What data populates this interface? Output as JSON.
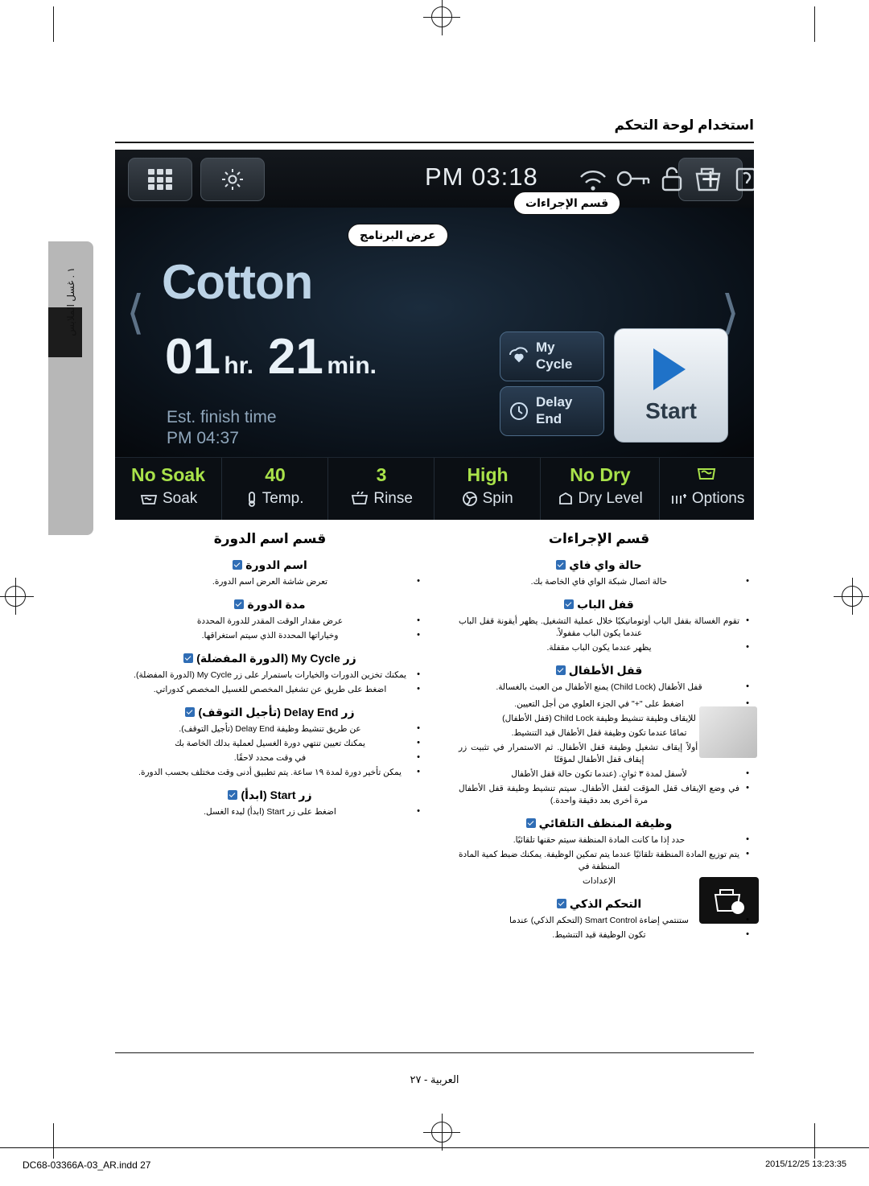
{
  "header": {
    "title": "استخدام لوحة التحكم"
  },
  "side_tab": {
    "label": "١ . غسل الملابس"
  },
  "footer": {
    "page_label": "العربية - ٢٧"
  },
  "print_bar": {
    "file": "DC68-03366A-03_AR.indd   27",
    "timestamp": "2015/12/25   13:23:35"
  },
  "display": {
    "clock": "PM 03:18",
    "icons": {
      "apps": "apps-grid-icon",
      "gear": "gear-icon",
      "plus": "plus-icon",
      "wifi": "wifi-icon",
      "key": "key-icon",
      "door_lock": "door-lock-icon",
      "detergent": "detergent-icon",
      "child_lock": "child-lock-icon"
    },
    "cycle_name": "Cotton",
    "hours": "01",
    "hours_unit": "hr.",
    "minutes": "21",
    "minutes_unit": "min.",
    "est_label": "Est. finish time",
    "est_time": "PM 04:37",
    "my_cycle": "My\nCycle",
    "my_cycle_line1": "My",
    "my_cycle_line2": "Cycle",
    "delay_line1": "Delay",
    "delay_line2": "End",
    "start": "Start",
    "options": [
      {
        "value": "No Soak",
        "name": "Soak",
        "icon": "soak-icon"
      },
      {
        "value": "40",
        "name": "Temp.",
        "icon": "thermometer-icon"
      },
      {
        "value": "3",
        "name": "Rinse",
        "icon": "rinse-icon"
      },
      {
        "value": "High",
        "name": "Spin",
        "icon": "spin-icon"
      },
      {
        "value": "No Dry",
        "name": "Dry Level",
        "icon": "dry-level-icon"
      },
      {
        "value": "",
        "name": "Options",
        "icon": "options-icon"
      }
    ],
    "callouts": {
      "program_display": "عرض البرنامج",
      "procedures_section": "قسم الإجراءات"
    }
  },
  "right_column": {
    "title": "قسم الإجراءات",
    "sections": [
      {
        "heading": "حالة واي فاي",
        "items": [
          "حالة اتصال شبكة الواي فاي الخاصة بك."
        ]
      },
      {
        "heading": "قفل الباب",
        "items": [
          "تقوم الغسالة بقفل الباب أوتوماتيكيًا خلال عملية التشغيل. يظهر أيقونة قفل الباب عندما يكون الباب مقفولاً.",
          "يظهر عندما يكون الباب مقفلة."
        ]
      },
      {
        "heading": "قفل الأطفال",
        "items": [
          "قفل الأطفال (Child Lock) يمنع الأطفال من العبث بالغسالة.",
          "اضغط على \"+\" في الجزء العلوي من أجل التعيين.",
          "للإيقاف وظيفة تنشيط وظيفة Child Lock (قفل الأطفال)",
          "تمامًا عندما تكون وظيفة قفل الأطفال قيد التنشيط.",
          "يجب عليك أولاً إيقاف تشغيل وظيفة قفل الأطفال. ثم الاستمرار في تثبيت زر إيقاف قفل الأطفال لمؤقتًا",
          "لأسفل لمدة ٣ ثوانٍ. (عندما تكون حالة قفل الأطفال",
          "في وضع الإيقاف قفل المؤقت لقفل الأطفال. سيتم تنشيط وظيفة قفل الأطفال مرة أخرى بعد دقيقة واحدة.)"
        ]
      },
      {
        "heading": "وظيفة المنظف التلقائي",
        "items": [
          "حدد إذا ما كانت المادة المنظفة سيتم حقنها تلقائيًا.",
          "يتم توزيع المادة المنظفة تلقائيًا عندما يتم تمكين الوظيفة. يمكنك ضبط كمية المادة المنظفة في",
          "الإعدادات"
        ]
      },
      {
        "heading": "التحكم الذكي",
        "items": [
          "ستنتمي إضاءة Smart Control (التحكم الذكي) عندما",
          "تكون الوظيفة قيد التنشيط."
        ]
      }
    ]
  },
  "left_column": {
    "title": "قسم اسم الدورة",
    "sections": [
      {
        "heading": "اسم الدورة",
        "items": [
          "تعرض شاشة العرض اسم الدورة."
        ]
      },
      {
        "heading": "مدة الدورة",
        "items": [
          "عرض مقدار الوقت المقدر للدورة المحددة",
          "وخياراتها المحددة الذي سيتم استغراقها."
        ]
      },
      {
        "heading": "زر My Cycle (الدورة المفضلة)",
        "items": [
          "يمكنك تخزين الدورات والخيارات باستمرار على زر My Cycle (الدورة المفضلة).",
          "اضغط على طريق عن تشغيل المخصص للغسيل المخصص كدوراتي."
        ]
      },
      {
        "heading": "زر Delay End (تأجيل التوقف)",
        "items": [
          "عن طريق تنشيط وظيفة Delay End (تأجيل التوقف).",
          "يمكنك تعيين تنتهي دورة الغسيل لعملية بدلك الخاصة بك",
          "في وقت محدد لاحقًا.",
          "يمكن تأخير دورة لمدة ١٩ ساعة. يتم تطبيق أدنى وقت مختلف بحسب الدورة."
        ]
      },
      {
        "heading": "زر Start (ابدأ)",
        "items": [
          "اضغط على زر Start (ابدأ) لبدء الغسل."
        ]
      }
    ]
  }
}
